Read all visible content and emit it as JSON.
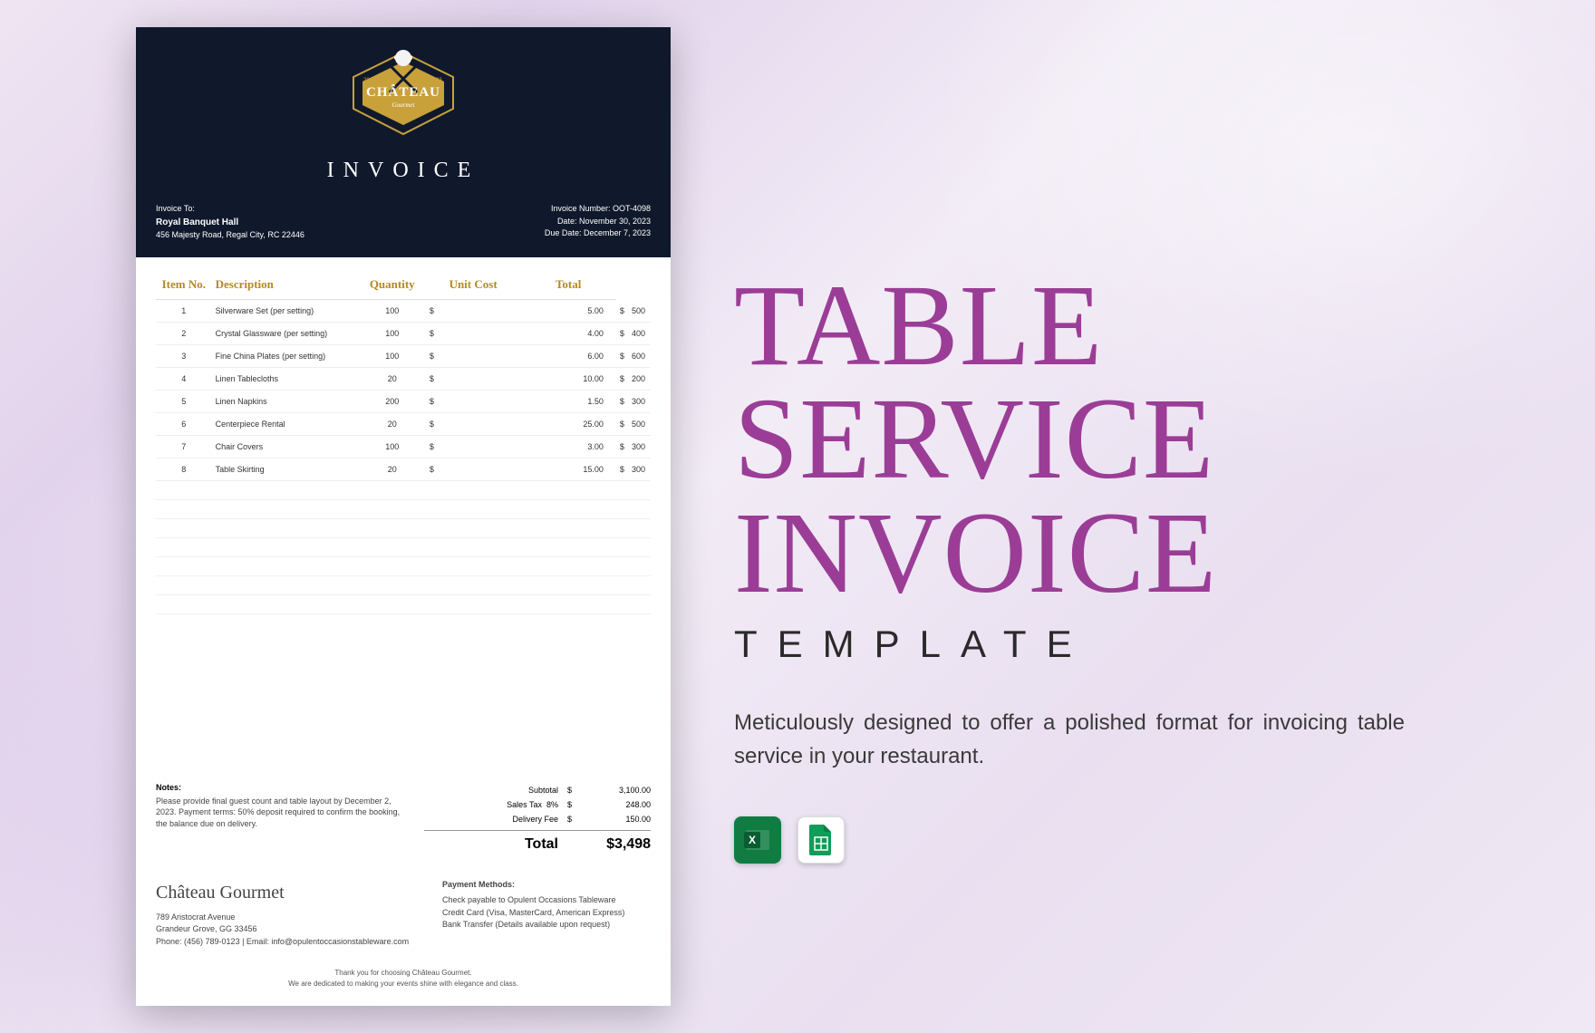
{
  "promo": {
    "title_l1": "Table",
    "title_l2": "Service",
    "title_l3": "Invoice",
    "subtitle": "TEMPLATE",
    "description": "Meticulously designed to offer a polished format for invoicing table service in your restaurant."
  },
  "invoice": {
    "brand_top": "CHÂTEAU",
    "brand_sub": "Gourmet",
    "doc_title": "INVOICE",
    "to_label": "Invoice To:",
    "to_name": "Royal Banquet Hall",
    "to_address": "456 Majesty Road, Regal City, RC 22446",
    "number_label": "Invoice Number: OOT-4098",
    "date_label": "Date: November 30, 2023",
    "due_label": "Due Date: December 7, 2023",
    "headers": {
      "item": "Item No.",
      "desc": "Description",
      "qty": "Quantity",
      "unit": "Unit Cost",
      "total": "Total"
    },
    "lines": [
      {
        "n": "1",
        "d": "Silverware Set (per setting)",
        "q": "100",
        "u": "5.00",
        "t": "500"
      },
      {
        "n": "2",
        "d": "Crystal Glassware (per setting)",
        "q": "100",
        "u": "4.00",
        "t": "400"
      },
      {
        "n": "3",
        "d": "Fine China Plates (per setting)",
        "q": "100",
        "u": "6.00",
        "t": "600"
      },
      {
        "n": "4",
        "d": "Linen Tablecloths",
        "q": "20",
        "u": "10.00",
        "t": "200"
      },
      {
        "n": "5",
        "d": "Linen Napkins",
        "q": "200",
        "u": "1.50",
        "t": "300"
      },
      {
        "n": "6",
        "d": "Centerpiece Rental",
        "q": "20",
        "u": "25.00",
        "t": "500"
      },
      {
        "n": "7",
        "d": "Chair Covers",
        "q": "100",
        "u": "3.00",
        "t": "300"
      },
      {
        "n": "8",
        "d": "Table Skirting",
        "q": "20",
        "u": "15.00",
        "t": "300"
      }
    ],
    "currency": "$",
    "notes_h": "Notes:",
    "notes_b": "Please provide final guest count and table layout by December 2, 2023. Payment terms: 50% deposit required to confirm the booking, the balance due on delivery.",
    "totals": {
      "subtotal_l": "Subtotal",
      "subtotal_v": "3,100.00",
      "tax_l": "Sales Tax",
      "tax_pct": "8%",
      "tax_v": "248.00",
      "ship_l": "Delivery Fee",
      "ship_v": "150.00",
      "grand_l": "Total",
      "grand_v": "$3,498"
    },
    "company": {
      "name": "Château Gourmet",
      "addr1": "789 Aristocrat Avenue",
      "addr2": "Grandeur Grove, GG 33456",
      "contact": "Phone: (456) 789-0123 | Email: info@opulentoccasionstableware.com"
    },
    "payment": {
      "h": "Payment Methods:",
      "l1": "Check payable to Opulent Occasions Tableware",
      "l2": "Credit Card (Visa, MasterCard, American Express)",
      "l3": "Bank Transfer (Details available upon request)"
    },
    "thanks_l1": "Thank you for choosing Château Gourmet.",
    "thanks_l2": "We are dedicated to making your events shine with elegance and class."
  }
}
